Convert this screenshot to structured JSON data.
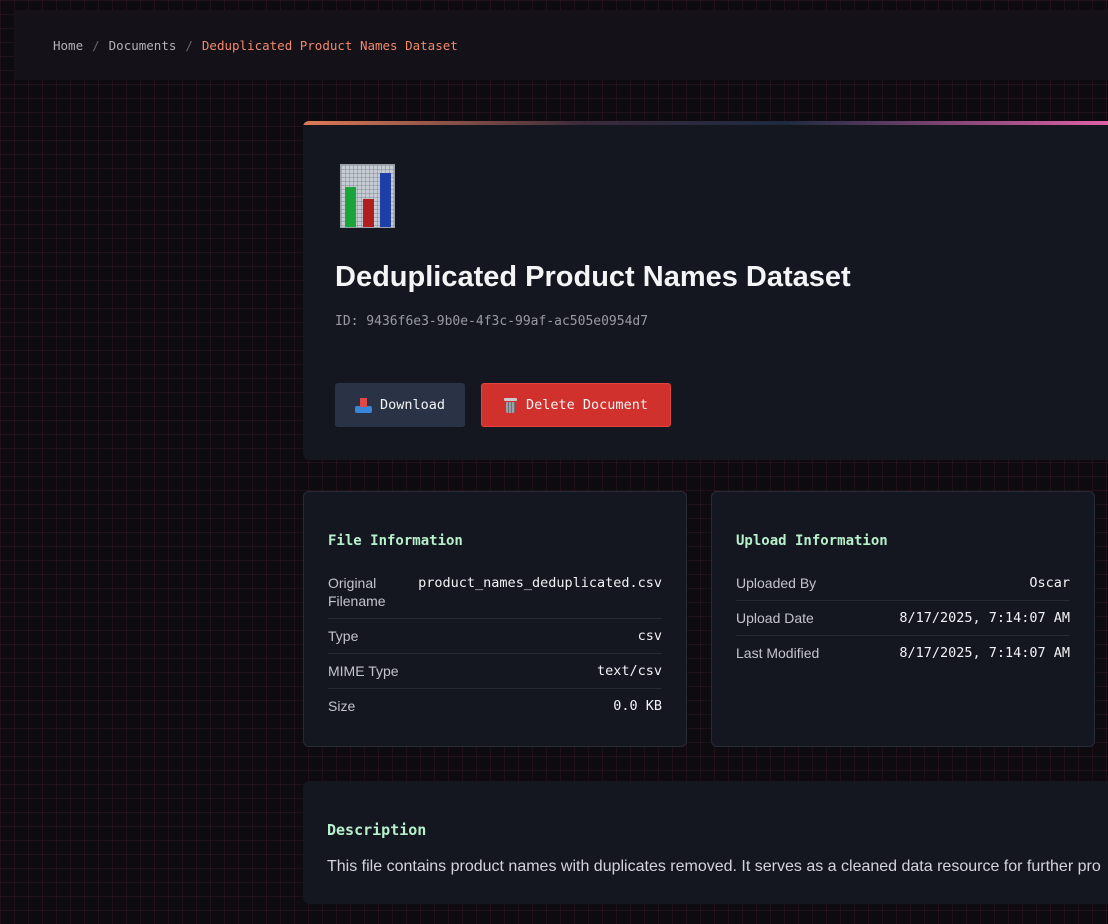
{
  "breadcrumb": {
    "items": [
      "Home",
      "Documents"
    ],
    "separator": "/",
    "current": "Deduplicated Product Names Dataset"
  },
  "document": {
    "icon": "bar-chart-icon",
    "title": "Deduplicated Product Names Dataset",
    "id_text": "ID: 9436f6e3-9b0e-4f3c-99af-ac505e0954d7"
  },
  "actions": {
    "download_label": "Download",
    "delete_label": "Delete Document"
  },
  "file_info": {
    "heading": "File Information",
    "rows": [
      {
        "label": "Original Filename",
        "value": "product_names_deduplicated.csv"
      },
      {
        "label": "Type",
        "value": "csv"
      },
      {
        "label": "MIME Type",
        "value": "text/csv"
      },
      {
        "label": "Size",
        "value": "0.0 KB"
      }
    ]
  },
  "upload_info": {
    "heading": "Upload Information",
    "rows": [
      {
        "label": "Uploaded By",
        "value": "Oscar"
      },
      {
        "label": "Upload Date",
        "value": "8/17/2025, 7:14:07 AM"
      },
      {
        "label": "Last Modified",
        "value": "8/17/2025, 7:14:07 AM"
      }
    ]
  },
  "description": {
    "heading": "Description",
    "text": "This file contains product names with duplicates removed. It serves as a cleaned data resource for further pro"
  },
  "colors": {
    "accent_orange": "#f08a6c",
    "heading_green": "#b8f0cc",
    "delete_red": "#d1312c",
    "download_bg": "#2a3346"
  }
}
